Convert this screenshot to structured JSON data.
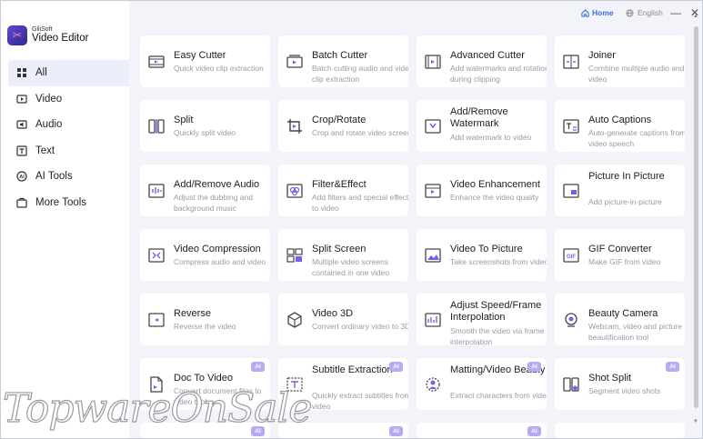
{
  "app": {
    "brand_sub": "GiliSoft",
    "brand_main": "Video Editor"
  },
  "topbar": {
    "home_label": "Home",
    "language_label": "English"
  },
  "sidebar": {
    "items": [
      {
        "label": "All",
        "icon": "grid-icon",
        "active": true
      },
      {
        "label": "Video",
        "icon": "video-icon"
      },
      {
        "label": "Audio",
        "icon": "audio-icon"
      },
      {
        "label": "Text",
        "icon": "text-icon"
      },
      {
        "label": "AI Tools",
        "icon": "ai-icon"
      },
      {
        "label": "More Tools",
        "icon": "more-tools-icon"
      }
    ]
  },
  "tools": [
    {
      "title": "Easy Cutter",
      "desc": "Quick video clip extraction",
      "icon": "film-icon"
    },
    {
      "title": "Batch Cutter",
      "desc": "Batch cutting audio and video clip extraction",
      "icon": "film-batch-icon"
    },
    {
      "title": "Advanced Cutter",
      "desc": "Add watermarks and rotation during clipping",
      "icon": "film-advanced-icon"
    },
    {
      "title": "Joiner",
      "desc": "Combine multiple audio and video",
      "icon": "join-icon"
    },
    {
      "title": "Split",
      "desc": "Quickly split video",
      "icon": "split-icon"
    },
    {
      "title": "Crop/Rotate",
      "desc": "Crop and rotate video screen",
      "icon": "crop-icon"
    },
    {
      "title": "Add/Remove Watermark",
      "desc": "Add watermark to video",
      "icon": "watermark-icon"
    },
    {
      "title": "Auto Captions",
      "desc": "Auto-generate captions from video speech",
      "icon": "captions-icon"
    },
    {
      "title": "Add/Remove Audio",
      "desc": "Adjust the dubbing and background music",
      "icon": "audio-edit-icon"
    },
    {
      "title": "Filter&Effect",
      "desc": "Add filters and special effects to video",
      "icon": "filter-icon"
    },
    {
      "title": "Video Enhancement",
      "desc": "Enhance the video quality",
      "icon": "enhance-icon"
    },
    {
      "title": "Picture In Picture",
      "desc": "Add picture-in-picture",
      "icon": "pip-icon"
    },
    {
      "title": "Video Compression",
      "desc": "Compress audio and video",
      "icon": "compress-icon"
    },
    {
      "title": "Split Screen",
      "desc": "Multiple video screens contained in one video",
      "icon": "split-screen-icon"
    },
    {
      "title": "Video To Picture",
      "desc": "Take screenshots from video",
      "icon": "picture-icon"
    },
    {
      "title": "GIF Converter",
      "desc": "Make GIF from video",
      "icon": "gif-icon"
    },
    {
      "title": "Reverse",
      "desc": "Reverse the video",
      "icon": "reverse-icon"
    },
    {
      "title": "Video 3D",
      "desc": "Convert ordinary video to 3D",
      "icon": "cube-icon"
    },
    {
      "title": "Adjust Speed/Frame Interpolation",
      "desc": "Smooth the video via frame interpolation",
      "icon": "speed-icon"
    },
    {
      "title": "Beauty Camera",
      "desc": "Webcam, video and picture beautification tool",
      "icon": "camera-icon"
    },
    {
      "title": "Doc To Video",
      "desc": "Convert document files to video tool",
      "icon": "doc-icon",
      "ai": true
    },
    {
      "title": "Subtitle Extraction",
      "desc": "Quickly extract subtitles from video",
      "icon": "subtitle-icon",
      "ai": true
    },
    {
      "title": "Matting/Video Beauty",
      "desc": "Extract characters from video",
      "icon": "matting-icon",
      "ai": true
    },
    {
      "title": "Shot Split",
      "desc": "Segment video shots",
      "icon": "shot-split-icon",
      "ai": true
    },
    {
      "title": "",
      "desc": "",
      "icon": "",
      "ai": true
    },
    {
      "title": "",
      "desc": "",
      "icon": "",
      "ai": true
    },
    {
      "title": "",
      "desc": "",
      "icon": "",
      "ai": true
    },
    {
      "title": "",
      "desc": "",
      "icon": "",
      "ai": false
    }
  ],
  "ai_badge_label": "AI",
  "watermark_text": "TopwareOnSale",
  "colors": {
    "accent": "#3a6ee8",
    "ai_badge": "#b9a8f3",
    "active_nav": "#eceefb",
    "background": "#f3f4fa"
  }
}
